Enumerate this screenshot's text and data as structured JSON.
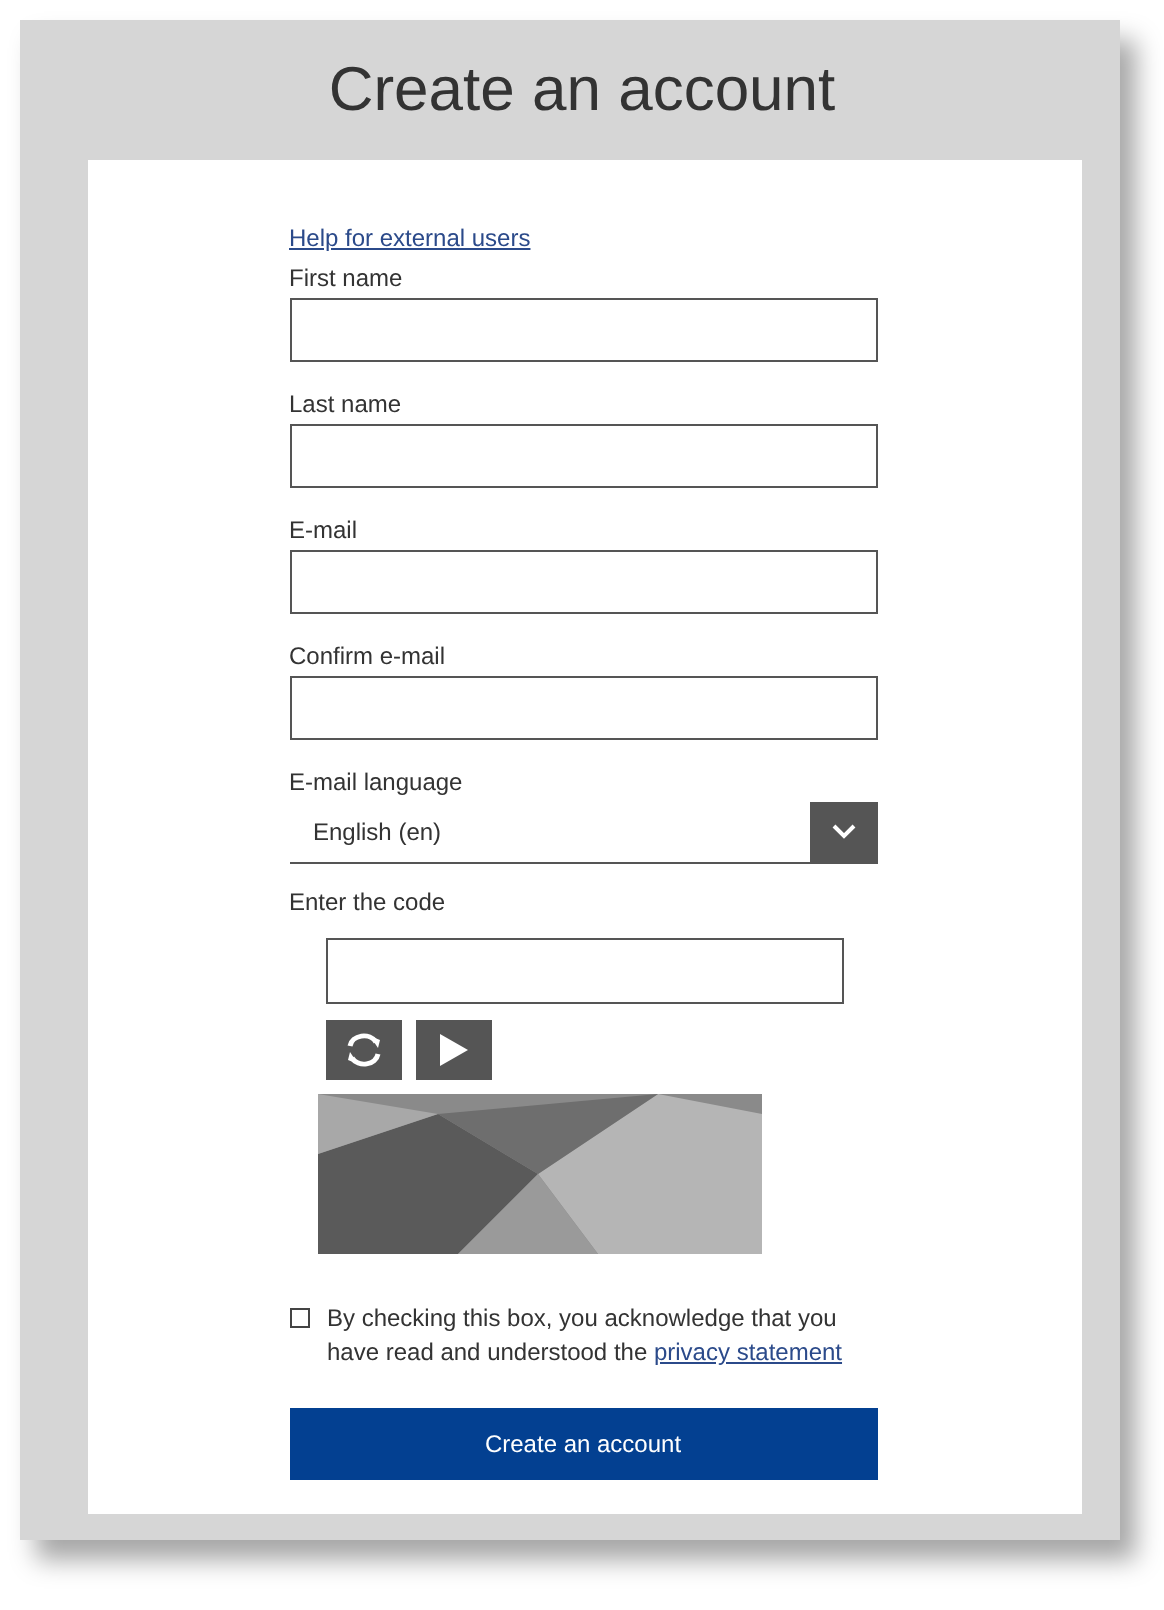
{
  "title": "Create an account",
  "help_link": "Help for external users",
  "fields": [
    {
      "label": "First name",
      "kind": "text"
    },
    {
      "label": "Last name",
      "kind": "text"
    },
    {
      "label": "E-mail",
      "kind": "text"
    },
    {
      "label": "Confirm e-mail",
      "kind": "text"
    },
    {
      "label": "E-mail language",
      "kind": "select",
      "value": "English (en)"
    }
  ],
  "captcha": {
    "label": "Enter the code"
  },
  "consent": {
    "checked": false,
    "text": "By checking this box, you acknowledge that you have read and understood the",
    "link": "privacy statement"
  },
  "submit": "Create an account"
}
